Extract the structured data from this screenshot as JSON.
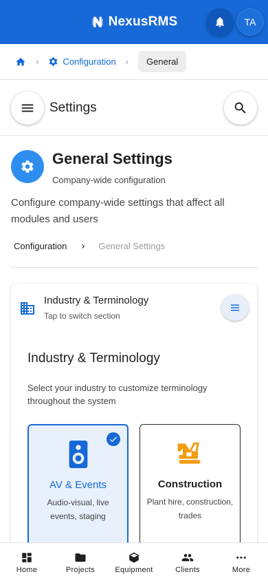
{
  "app": {
    "brand": "NexusRMS",
    "avatar_initials": "TA",
    "accent": "#1669d6"
  },
  "breadcrumb": {
    "home_icon": "home-icon",
    "items": [
      "Configuration",
      "General"
    ]
  },
  "settings_header": {
    "title": "Settings",
    "menu_icon": "hamburger-icon",
    "search_icon": "search-icon"
  },
  "page": {
    "title": "General Settings",
    "subtitle": "Company-wide configuration",
    "description": "Configure company-wide settings that affect all modules and users",
    "crumbs": [
      "Configuration",
      "General Settings"
    ]
  },
  "card": {
    "title": "Industry & Terminology",
    "subtitle": "Tap to switch section",
    "section_title": "Industry & Terminology",
    "section_desc": "Select your industry to customize terminology throughout the system",
    "options": [
      {
        "title": "AV & Events",
        "desc": "Audio-visual, live events, staging",
        "icon": "speaker-icon",
        "selected": true
      },
      {
        "title": "Construction",
        "desc": "Plant hire, construction, trades",
        "icon": "excavator-icon",
        "selected": false
      }
    ]
  },
  "bottom_nav": [
    {
      "label": "Home",
      "icon": "dashboard-icon"
    },
    {
      "label": "Projects",
      "icon": "folder-icon"
    },
    {
      "label": "Equipment",
      "icon": "box-icon"
    },
    {
      "label": "Clients",
      "icon": "people-icon"
    },
    {
      "label": "More",
      "icon": "more-icon"
    }
  ]
}
